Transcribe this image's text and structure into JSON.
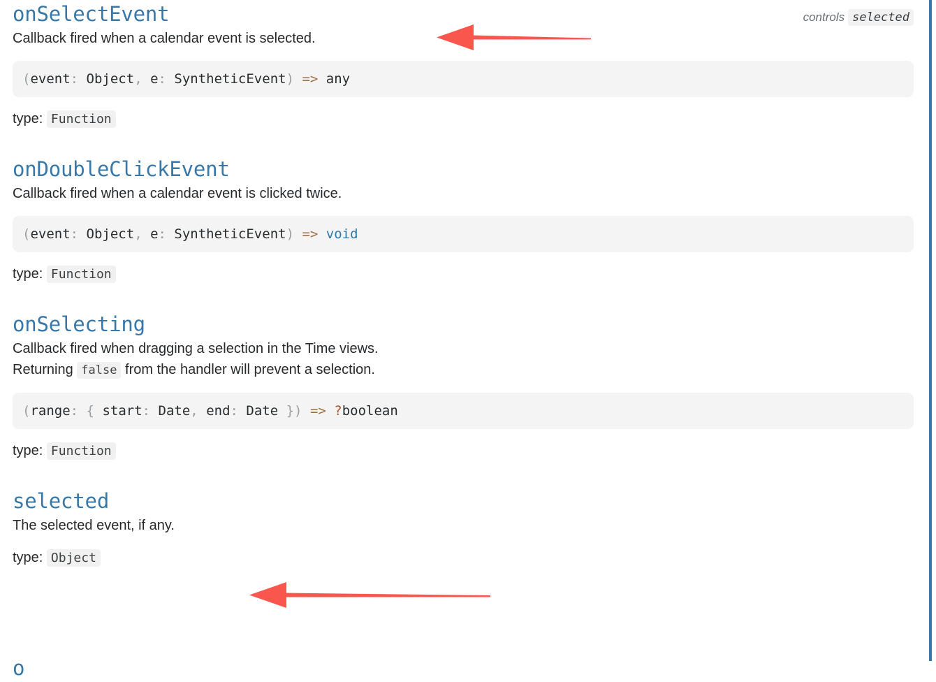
{
  "page": {
    "accent_heading_color": "#3878a8",
    "annotation_color": "#f9574e",
    "edge_rule_color": "#3c78ab",
    "next_section_peek": "o"
  },
  "props": [
    {
      "name": "onSelectEvent",
      "controls_label": "controls",
      "controls_target": "selected",
      "descriptions": [
        {
          "parts": [
            {
              "text": "Callback fired when a calendar event is selected.",
              "code": false
            }
          ]
        }
      ],
      "signature": [
        {
          "text": "(",
          "style": "punct"
        },
        {
          "text": "event",
          "style": "ident"
        },
        {
          "text": ": ",
          "style": "punct"
        },
        {
          "text": "Object",
          "style": "ident"
        },
        {
          "text": ", ",
          "style": "punct"
        },
        {
          "text": "e",
          "style": "ident"
        },
        {
          "text": ": ",
          "style": "punct"
        },
        {
          "text": "SyntheticEvent",
          "style": "ident"
        },
        {
          "text": ")",
          "style": "punct"
        },
        {
          "text": " => ",
          "style": "arrow"
        },
        {
          "text": "any",
          "style": "ident"
        }
      ],
      "type_label": "type:",
      "type_value": "Function"
    },
    {
      "name": "onDoubleClickEvent",
      "controls_label": null,
      "controls_target": null,
      "descriptions": [
        {
          "parts": [
            {
              "text": "Callback fired when a calendar event is clicked twice.",
              "code": false
            }
          ]
        }
      ],
      "signature": [
        {
          "text": "(",
          "style": "punct"
        },
        {
          "text": "event",
          "style": "ident"
        },
        {
          "text": ": ",
          "style": "punct"
        },
        {
          "text": "Object",
          "style": "ident"
        },
        {
          "text": ", ",
          "style": "punct"
        },
        {
          "text": "e",
          "style": "ident"
        },
        {
          "text": ": ",
          "style": "punct"
        },
        {
          "text": "SyntheticEvent",
          "style": "ident"
        },
        {
          "text": ")",
          "style": "punct"
        },
        {
          "text": " => ",
          "style": "arrow"
        },
        {
          "text": "void",
          "style": "kw"
        }
      ],
      "type_label": "type:",
      "type_value": "Function"
    },
    {
      "name": "onSelecting",
      "controls_label": null,
      "controls_target": null,
      "descriptions": [
        {
          "parts": [
            {
              "text": "Callback fired when dragging a selection in the Time views.",
              "code": false
            }
          ]
        },
        {
          "parts": [
            {
              "text": "Returning ",
              "code": false
            },
            {
              "text": "false",
              "code": true
            },
            {
              "text": " from the handler will prevent a selection.",
              "code": false
            }
          ]
        }
      ],
      "signature": [
        {
          "text": "(",
          "style": "punct"
        },
        {
          "text": "range",
          "style": "ident"
        },
        {
          "text": ": ",
          "style": "punct"
        },
        {
          "text": "{ ",
          "style": "punct"
        },
        {
          "text": "start",
          "style": "ident"
        },
        {
          "text": ": ",
          "style": "punct"
        },
        {
          "text": "Date",
          "style": "ident"
        },
        {
          "text": ", ",
          "style": "punct"
        },
        {
          "text": "end",
          "style": "ident"
        },
        {
          "text": ": ",
          "style": "punct"
        },
        {
          "text": "Date",
          "style": "ident"
        },
        {
          "text": " })",
          "style": "punct"
        },
        {
          "text": " => ",
          "style": "arrow"
        },
        {
          "text": "?",
          "style": "opt"
        },
        {
          "text": "boolean",
          "style": "ident"
        }
      ],
      "type_label": "type:",
      "type_value": "Function"
    },
    {
      "name": "selected",
      "controls_label": null,
      "controls_target": null,
      "descriptions": [
        {
          "parts": [
            {
              "text": "The selected event, if any.",
              "code": false
            }
          ]
        }
      ],
      "signature": null,
      "type_label": "type:",
      "type_value": "Object"
    }
  ],
  "annotations": [
    {
      "id": "arrow-1",
      "points_to": "onSelectEvent-heading"
    },
    {
      "id": "arrow-2",
      "points_to": "selected-description"
    }
  ]
}
